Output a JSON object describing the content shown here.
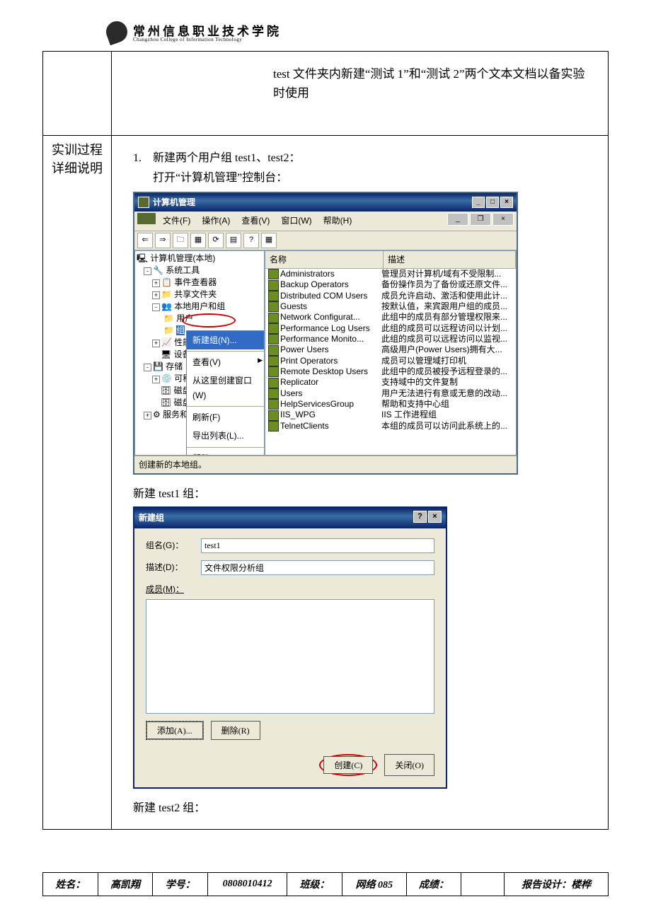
{
  "header": {
    "school_cn": "常州信息职业技术学院",
    "school_en": "Changzhou College of Information Technology"
  },
  "top_note": "test 文件夹内新建“测试 1”和“测试 2”两个文本文档以备实验时使用",
  "side_label_l1": "实训过程",
  "side_label_l2": "详细说明",
  "step1_num": "1.",
  "step1_line1": "新建两个用户组 test1、test2：",
  "step1_line2": "打开“计算机管理”控制台：",
  "cm": {
    "title": "计算机管理",
    "menus": [
      "文件(F)",
      "操作(A)",
      "查看(V)",
      "窗口(W)",
      "帮助(H)"
    ],
    "tree": {
      "root": "计算机管理(本地)",
      "n1": "系统工具",
      "n1a": "事件查看器",
      "n1b": "共享文件夹",
      "n1c": "本地用户和组",
      "n1c1": "用户",
      "n1c2": "组",
      "n1d": "性能",
      "n1e": "设备",
      "n2": "存储",
      "n2a": "可移",
      "n2b": "磁盘",
      "n2c": "磁盘",
      "n3": "服务和"
    },
    "ctx": {
      "new_group": "新建组(N)...",
      "view": "查看(V)",
      "from_here": "从这里创建窗口(W)",
      "refresh": "刷新(F)",
      "export": "导出列表(L)...",
      "help": "帮助(H)"
    },
    "cols": {
      "name": "名称",
      "desc": "描述"
    },
    "rows": [
      {
        "n": "Administrators",
        "d": "管理员对计算机/域有不受限制..."
      },
      {
        "n": "Backup Operators",
        "d": "备份操作员为了备份或还原文件..."
      },
      {
        "n": "Distributed COM Users",
        "d": "成员允许启动、激活和使用此计..."
      },
      {
        "n": "Guests",
        "d": "按默认值，来宾跟用户组的成员..."
      },
      {
        "n": "Network Configurat...",
        "d": "此组中的成员有部分管理权限来..."
      },
      {
        "n": "Performance Log Users",
        "d": "此组的成员可以远程访问以计划..."
      },
      {
        "n": "Performance Monito...",
        "d": "此组的成员可以远程访问以监视..."
      },
      {
        "n": "Power Users",
        "d": "高级用户(Power Users)拥有大..."
      },
      {
        "n": "Print Operators",
        "d": "成员可以管理域打印机"
      },
      {
        "n": "Remote Desktop Users",
        "d": "此组中的成员被授予远程登录的..."
      },
      {
        "n": "Replicator",
        "d": "支持域中的文件复制"
      },
      {
        "n": "Users",
        "d": "用户无法进行有意或无意的改动..."
      },
      {
        "n": "HelpServicesGroup",
        "d": "帮助和支持中心组"
      },
      {
        "n": "IIS_WPG",
        "d": "IIS 工作进程组"
      },
      {
        "n": "TelnetClients",
        "d": "本组的成员可以访问此系统上的..."
      }
    ],
    "status": "创建新的本地组。"
  },
  "step2_line": "新建 test1 组：",
  "dlg": {
    "title": "新建组",
    "lbl_name": "组名(G)：",
    "val_name": "test1",
    "lbl_desc": "描述(D)：",
    "val_desc": "文件权限分析组",
    "lbl_members": "成员(M)：",
    "btn_add": "添加(A)...",
    "btn_remove": "删除(R)",
    "btn_create": "创建(C)",
    "btn_close": "关闭(O)"
  },
  "step3_line": "新建 test2 组：",
  "footer": {
    "lbl_name": "姓名：",
    "val_name": "高凯翔",
    "lbl_id": "学号：",
    "val_id": "0808010412",
    "lbl_class": "班级：",
    "val_class": "网络 085",
    "lbl_grade": "成绩：",
    "val_grade": "",
    "report": "报告设计：楼桦"
  }
}
